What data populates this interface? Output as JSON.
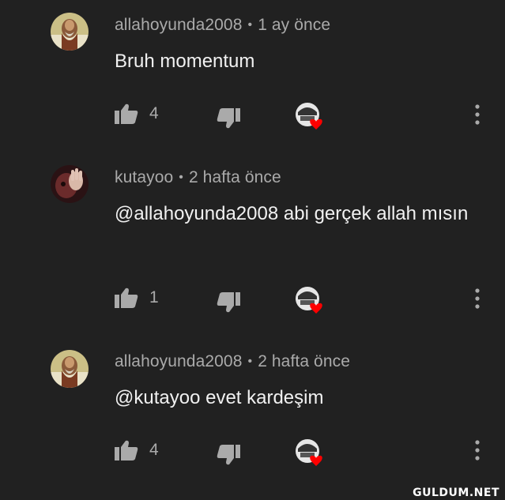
{
  "comments": [
    {
      "author": "allahoyunda2008",
      "separator": "•",
      "time": "1 ay önce",
      "text": "Bruh momentum",
      "likes": "4",
      "avatar_icon": "bearded-man-painting-avatar",
      "heart": true
    },
    {
      "author": "kutayoo",
      "separator": "•",
      "time": "2 hafta önce",
      "text": "@allahoyunda2008 abi gerçek allah mısın",
      "likes": "1",
      "avatar_icon": "dark-hand-avatar",
      "heart": true
    },
    {
      "author": "allahoyunda2008",
      "separator": "•",
      "time": "2 hafta önce",
      "text": "@kutayoo evet kardeşim",
      "likes": "4",
      "avatar_icon": "bearded-man-painting-avatar",
      "heart": true
    }
  ],
  "watermark": "GULDUM.NET",
  "colors": {
    "background": "#212121",
    "text_primary": "#f1f1f1",
    "text_secondary": "#aaaaaa",
    "heart": "#ff0000"
  }
}
